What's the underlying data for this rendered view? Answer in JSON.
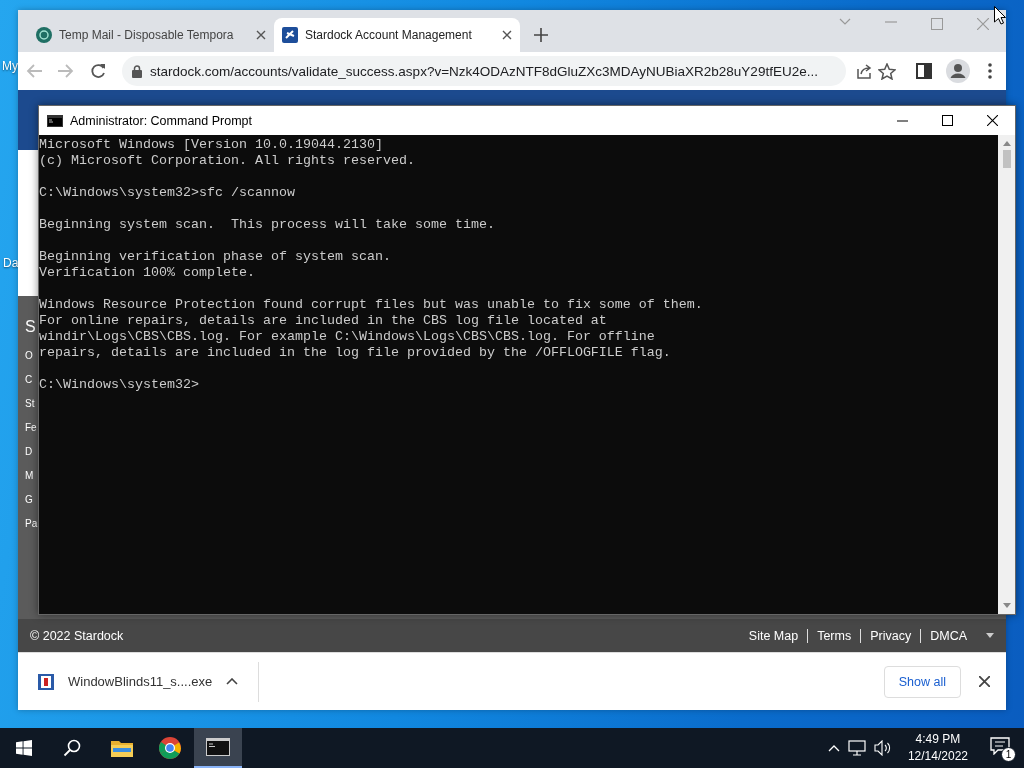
{
  "desktop": {
    "icon_labels": [
      "My",
      "Da"
    ]
  },
  "browser": {
    "tabs": [
      {
        "kind": "tempmail",
        "title": "Temp Mail - Disposable Tempora",
        "selected": false
      },
      {
        "kind": "stardock",
        "title": "Stardock Account Management",
        "selected": true
      }
    ],
    "address": "stardock.com/accounts/validate_success.aspx?v=Nzk4ODAzNTF8dGluZXc3MDAyNUBiaXR2b28uY29tfEU2e...",
    "page": {
      "menu_fragments": [
        "S",
        "O",
        "C",
        "St",
        "Fe",
        "D",
        "M",
        "G",
        "Pa"
      ],
      "footer": {
        "copyright": "© 2022 Stardock",
        "links": [
          "Site Map",
          "Terms",
          "Privacy",
          "DMCA"
        ]
      }
    },
    "download_bar": {
      "file": "WindowBlinds11_s....exe",
      "show_all": "Show all"
    }
  },
  "console": {
    "title": "Administrator: Command Prompt",
    "blocks": [
      [
        "Microsoft Windows [Version 10.0.19044.2130]",
        "(c) Microsoft Corporation. All rights reserved."
      ],
      [
        "C:\\Windows\\system32>sfc /scannow"
      ],
      [
        "Beginning system scan.  This process will take some time."
      ],
      [
        "Beginning verification phase of system scan.",
        "Verification 100% complete."
      ],
      [
        "Windows Resource Protection found corrupt files but was unable to fix some of them.",
        "For online repairs, details are included in the CBS log file located at",
        "windir\\Logs\\CBS\\CBS.log. For example C:\\Windows\\Logs\\CBS\\CBS.log. For offline",
        "repairs, details are included in the log file provided by the /OFFLOGFILE flag."
      ],
      [
        "C:\\Windows\\system32>"
      ]
    ]
  },
  "taskbar": {
    "apps": [
      {
        "kind": "start",
        "selected": false
      },
      {
        "kind": "search",
        "selected": false
      },
      {
        "kind": "explorer",
        "selected": false
      },
      {
        "kind": "chrome",
        "selected": false
      },
      {
        "kind": "console",
        "selected": true
      }
    ],
    "time": "4:49 PM",
    "date": "12/14/2022",
    "notifications": "1"
  }
}
